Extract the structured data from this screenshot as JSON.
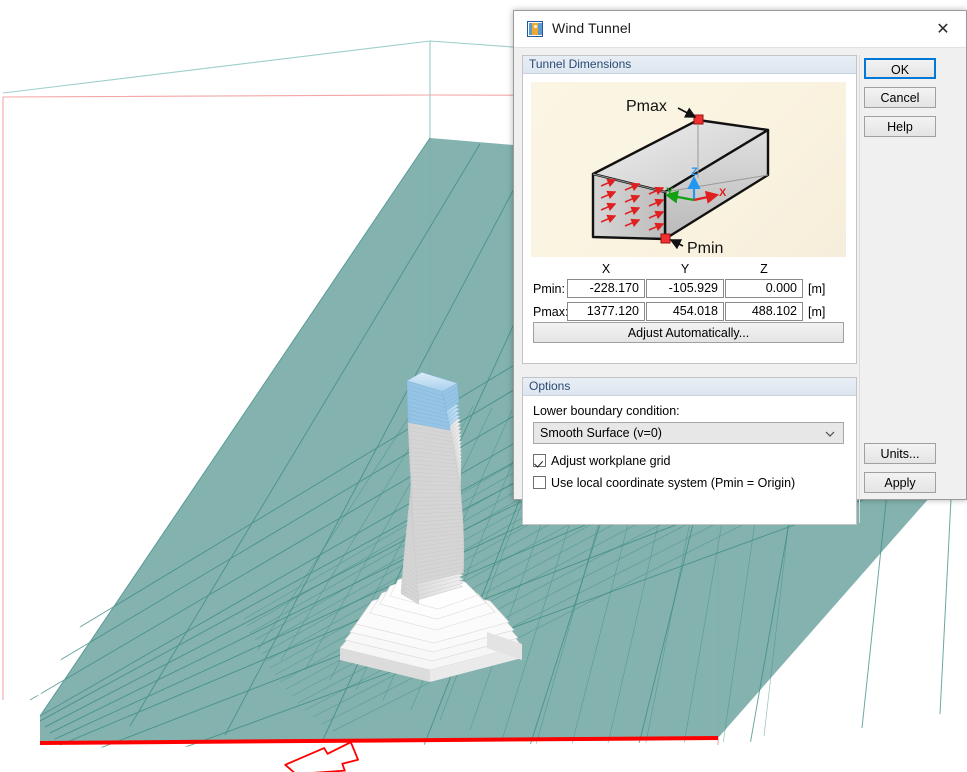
{
  "dialog": {
    "title": "Wind Tunnel",
    "icon": "app-icon",
    "close_label": "✕"
  },
  "groups": {
    "dimensions": {
      "title": "Tunnel Dimensions"
    },
    "options": {
      "title": "Options"
    }
  },
  "illustration": {
    "pmax_label": "Pmax",
    "pmin_label": "Pmin",
    "axis_x": "X",
    "axis_y": "Y",
    "axis_z": "Z"
  },
  "coordinates": {
    "headers": [
      "X",
      "Y",
      "Z"
    ],
    "rows": [
      {
        "label": "Pmin:",
        "x": "-228.170",
        "y": "-105.929",
        "z": "0.000",
        "unit": "[m]"
      },
      {
        "label": "Pmax:",
        "x": "1377.120",
        "y": "454.018",
        "z": "488.102",
        "unit": "[m]"
      }
    ],
    "adjust_button": "Adjust Automatically..."
  },
  "options": {
    "lower_boundary_label": "Lower boundary condition:",
    "lower_boundary_value": "Smooth Surface (v=0)",
    "checkboxes": [
      {
        "label": "Adjust workplane grid",
        "checked": true
      },
      {
        "label": "Use local coordinate system (Pmin = Origin)",
        "checked": false
      }
    ]
  },
  "buttons": {
    "ok": "OK",
    "cancel": "Cancel",
    "help": "Help",
    "units": "Units...",
    "apply": "Apply"
  },
  "colors": {
    "accent": "#0078d7",
    "ground": "#7aada8",
    "grid_line": "#3d8a84",
    "boundary_red": "#ff0000",
    "wireframe_teal": "#9ecfcb",
    "wireframe_pink": "#f4a5a5",
    "building_white": "#ededed",
    "building_top_blue": "#bdddf2"
  }
}
